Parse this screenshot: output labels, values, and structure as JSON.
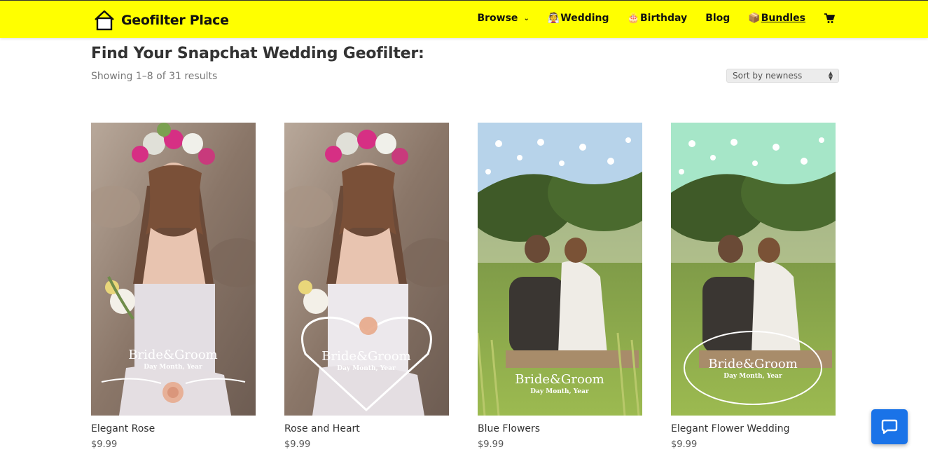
{
  "header": {
    "logo_text": "Geofilter Place",
    "nav": [
      {
        "label": "Browse",
        "icon": "chevron-down-icon"
      },
      {
        "label": "Wedding",
        "emoji": "👰"
      },
      {
        "label": "Birthday",
        "emoji": "🎂"
      },
      {
        "label": "Blog"
      },
      {
        "label": "Bundles",
        "emoji": "📦"
      }
    ]
  },
  "main": {
    "title": "Find Your Snapchat Wedding Geofilter:",
    "result_count": "Showing 1–8 of 31 results",
    "sort": {
      "selected": "Sort by newness"
    },
    "products": [
      {
        "name": "Elegant Rose",
        "price": "$9.99",
        "overlay_title": "Bride&Groom",
        "overlay_sub": "Day Month, Year"
      },
      {
        "name": "Rose and Heart",
        "price": "$9.99",
        "overlay_title": "Bride&Groom",
        "overlay_sub": "Day Month, Year"
      },
      {
        "name": "Blue Flowers",
        "price": "$9.99",
        "overlay_title": "Bride&Groom",
        "overlay_sub": "Day Month, Year"
      },
      {
        "name": "Elegant Flower Wedding",
        "price": "$9.99",
        "overlay_title": "Bride&Groom",
        "overlay_sub": "Day Month, Year"
      }
    ]
  },
  "colors": {
    "header_bg": "#ffff00",
    "chat_button": "#1a73e8"
  }
}
